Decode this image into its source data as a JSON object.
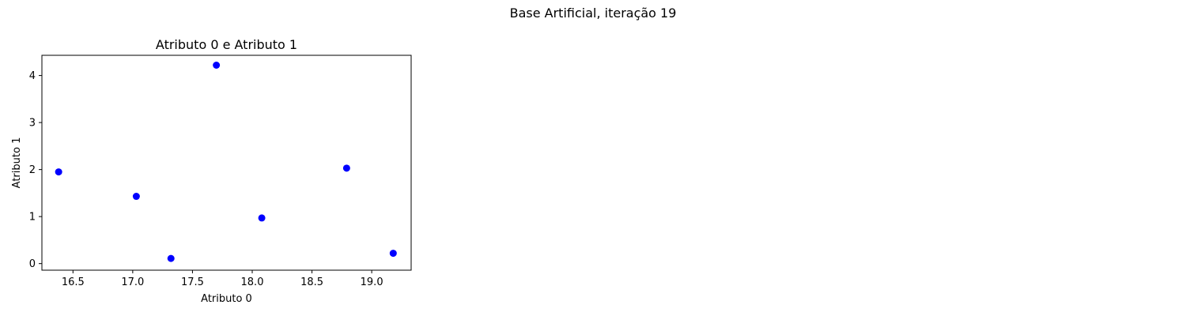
{
  "figure": {
    "suptitle": "Base Artificial, iteração 19"
  },
  "chart_data": {
    "type": "scatter",
    "title": "Atributo 0 e Atributo 1",
    "xlabel": "Atributo 0",
    "ylabel": "Atributo 1",
    "xlim": [
      16.24,
      19.33
    ],
    "ylim": [
      -0.14,
      4.43
    ],
    "xticks": [
      16.5,
      17.0,
      17.5,
      18.0,
      18.5,
      19.0
    ],
    "xtick_labels": [
      "16.5",
      "17.0",
      "17.5",
      "18.0",
      "18.5",
      "19.0"
    ],
    "yticks": [
      0,
      1,
      2,
      3,
      4
    ],
    "ytick_labels": [
      "0",
      "1",
      "2",
      "3",
      "4"
    ],
    "grid": false,
    "marker_color": "#0000ff",
    "points": [
      {
        "x": 16.38,
        "y": 1.95
      },
      {
        "x": 17.03,
        "y": 1.43
      },
      {
        "x": 17.32,
        "y": 0.11
      },
      {
        "x": 17.7,
        "y": 4.22
      },
      {
        "x": 18.08,
        "y": 0.97
      },
      {
        "x": 18.79,
        "y": 2.03
      },
      {
        "x": 19.18,
        "y": 0.22
      }
    ]
  }
}
